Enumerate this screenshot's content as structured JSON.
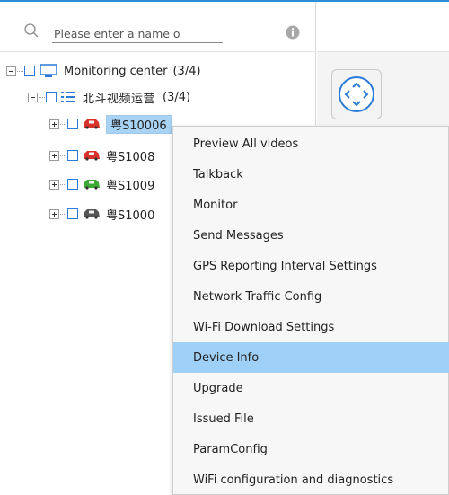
{
  "search": {
    "placeholder": "Please enter a name o"
  },
  "tree": {
    "root": {
      "label": "Monitoring center",
      "count": "(3/4)"
    },
    "group": {
      "label": "北斗视频运营",
      "count": "(3/4)"
    },
    "vehicles": [
      {
        "label": "粤S10006",
        "color": "#d9322a",
        "selected": true
      },
      {
        "label": "粤S1008",
        "color": "#d9322a",
        "selected": false
      },
      {
        "label": "粤S1009",
        "color": "#3aaa35",
        "selected": false
      },
      {
        "label": "粤S1000",
        "color": "#555555",
        "selected": false
      }
    ]
  },
  "context_menu": {
    "items": [
      {
        "label": "Preview All videos"
      },
      {
        "label": "Talkback"
      },
      {
        "label": "Monitor"
      },
      {
        "label": "Send Messages"
      },
      {
        "label": "GPS Reporting Interval Settings"
      },
      {
        "label": "Network Traffic Config"
      },
      {
        "label": "Wi-Fi Download Settings"
      },
      {
        "label": "Device Info",
        "active": true
      },
      {
        "label": "Upgrade"
      },
      {
        "label": "Issued File"
      },
      {
        "label": "ParamConfig"
      },
      {
        "label": "WiFi configuration and diagnostics"
      }
    ]
  },
  "icons": {
    "search": "search-icon",
    "info": "info-icon",
    "monitor": "monitor-icon",
    "list": "list-icon",
    "car": "car-icon",
    "ptz": "ptz-direction-icon"
  },
  "colors": {
    "accent": "#2b7bd6",
    "selection": "#a9d3f5",
    "menu_highlight": "#9fd0f8"
  }
}
